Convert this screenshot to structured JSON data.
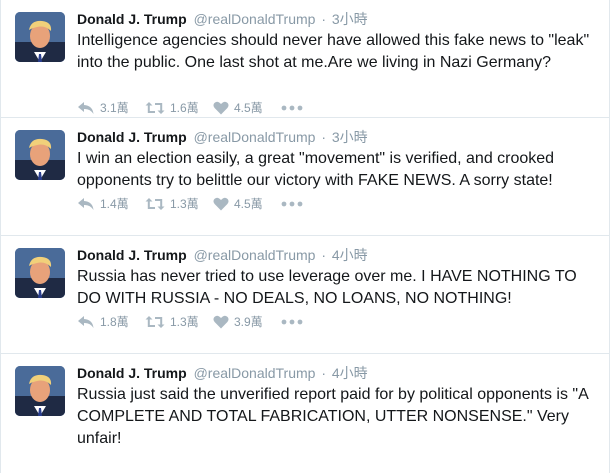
{
  "colors": {
    "name": "#14171a",
    "muted": "#8899a6",
    "divider": "#e1e8ed",
    "background": "#ffffff"
  },
  "tweets": [
    {
      "name": "Donald J. Trump",
      "handle": "@realDonaldTrump",
      "separator": "·",
      "time": "3小時",
      "text": "Intelligence agencies should never have allowed this fake news to \"leak\" into the public. One last shot at me.Are we living in Nazi Germany?",
      "reply_count": "3.1萬",
      "retweet_count": "1.6萬",
      "like_count": "4.5萬"
    },
    {
      "name": "Donald J. Trump",
      "handle": "@realDonaldTrump",
      "separator": "·",
      "time": "3小時",
      "text": "I win an election easily, a great \"movement\" is verified, and crooked opponents try to belittle our victory with FAKE NEWS. A sorry state!",
      "reply_count": "1.4萬",
      "retweet_count": "1.3萬",
      "like_count": "4.5萬"
    },
    {
      "name": "Donald J. Trump",
      "handle": "@realDonaldTrump",
      "separator": "·",
      "time": "4小時",
      "text": "Russia has never tried to use leverage over me. I HAVE NOTHING TO DO WITH RUSSIA - NO DEALS, NO LOANS, NO NOTHING!",
      "reply_count": "1.8萬",
      "retweet_count": "1.3萬",
      "like_count": "3.9萬"
    },
    {
      "name": "Donald J. Trump",
      "handle": "@realDonaldTrump",
      "separator": "·",
      "time": "4小時",
      "text": "Russia just said the unverified report paid for by political opponents is \"A COMPLETE AND TOTAL FABRICATION, UTTER NONSENSE.\" Very unfair!"
    }
  ],
  "icons": {
    "avatar": "profile-photo",
    "reply": "reply-arrow-icon",
    "retweet": "retweet-icon",
    "like": "heart-icon",
    "more": "more-dots-icon"
  }
}
